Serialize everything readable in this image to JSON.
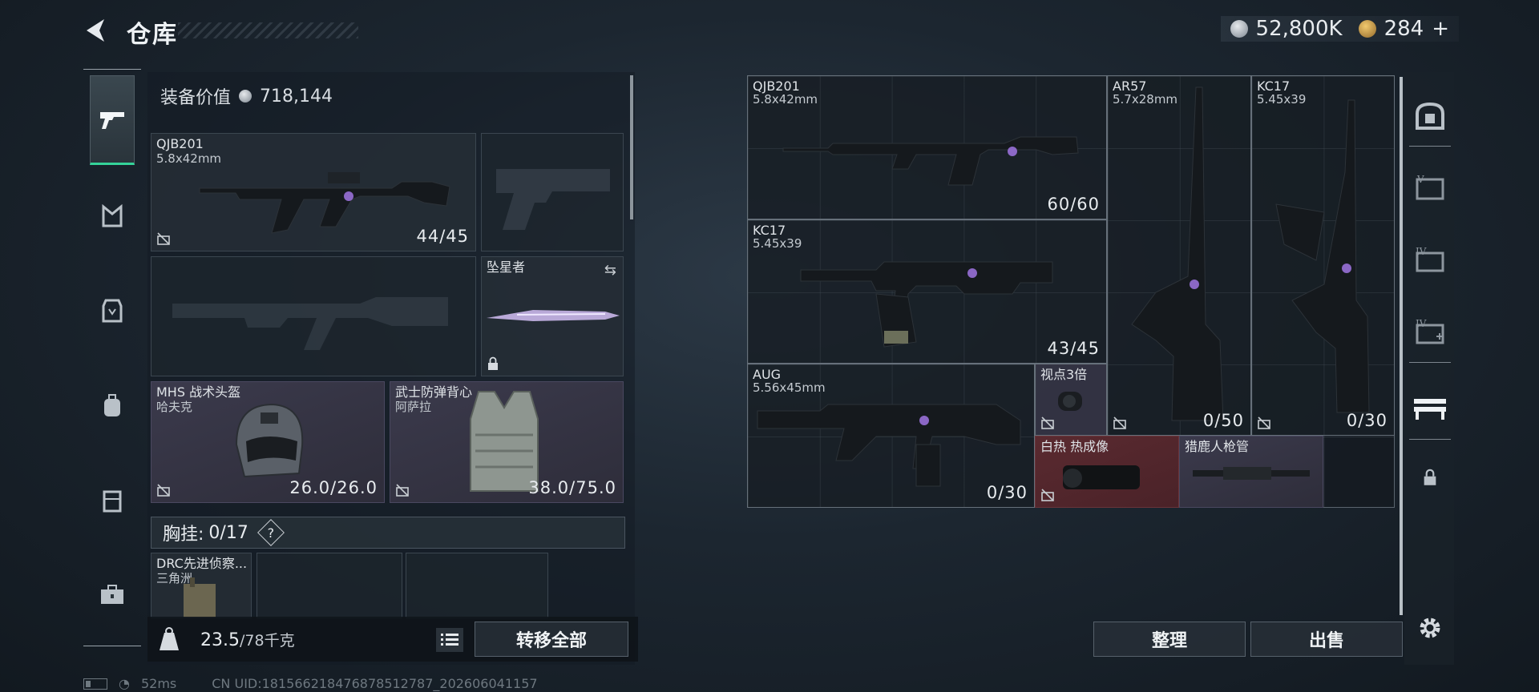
{
  "header": {
    "title": "仓库",
    "silver_amount": "52,800K",
    "gold_amount": "284",
    "gold_plus": "+"
  },
  "left_nav": {
    "items": [
      {
        "icon": "pistol-icon",
        "active": true
      },
      {
        "icon": "helmet-mask-icon"
      },
      {
        "icon": "vest-icon"
      },
      {
        "icon": "backpack-icon"
      },
      {
        "icon": "rig-icon"
      },
      {
        "icon": "toolbox-icon"
      }
    ]
  },
  "equipment": {
    "value_label": "装备价值",
    "value": "718,144",
    "primary": {
      "name": "QJB201",
      "caliber": "5.8x42mm",
      "ammo": "44/45"
    },
    "melee": {
      "name": "坠星者"
    },
    "helmet": {
      "name": "MHS 战术头盔",
      "brand": "哈夫克",
      "durability": "26.0/26.0"
    },
    "armor": {
      "name": "武士防弹背心",
      "brand": "阿萨拉",
      "durability": "38.0/75.0"
    },
    "chest_rig_label": "胸挂:",
    "chest_rig_capacity": "0/17",
    "help_glyph": "?",
    "rig_item": {
      "name": "DRC先进侦察...",
      "brand": "三角洲"
    }
  },
  "bottom": {
    "weight": "23.5",
    "weight_max": "/78千克",
    "transfer_all": "转移全部"
  },
  "status": {
    "ping": "52ms",
    "uid": "CN UID:1815662184768785127​87_202606041157"
  },
  "storage": {
    "items": [
      {
        "name": "QJB201",
        "caliber": "5.8x42mm",
        "ammo": "60/60"
      },
      {
        "name": "AR57",
        "caliber": "5.7x28mm",
        "ammo": "0/50"
      },
      {
        "name": "KC17",
        "caliber": "5.45x39",
        "ammo": "0/30"
      },
      {
        "name": "KC17",
        "caliber": "5.45x39",
        "ammo": "43/45"
      },
      {
        "name": "AUG",
        "caliber": "5.56x45mm",
        "ammo": "0/30"
      },
      {
        "name": "视点3倍"
      },
      {
        "name": "白热 热成像"
      },
      {
        "name": "猎鹿人枪管"
      }
    ],
    "sort_button": "整理",
    "sell_button": "出售"
  },
  "right_nav": {
    "items": [
      {
        "icon": "safe-icon"
      },
      {
        "icon": "card-v-icon"
      },
      {
        "icon": "case-iv-icon"
      },
      {
        "icon": "medkit-iv-icon"
      },
      {
        "icon": "weapon-rack-icon",
        "active": true
      },
      {
        "icon": "lock-icon"
      },
      {
        "icon": "settings-icon"
      }
    ]
  },
  "colors": {
    "accent_green": "#34d399",
    "purple_slot": "#3b3a4c",
    "red_slot": "#5a2a30"
  }
}
